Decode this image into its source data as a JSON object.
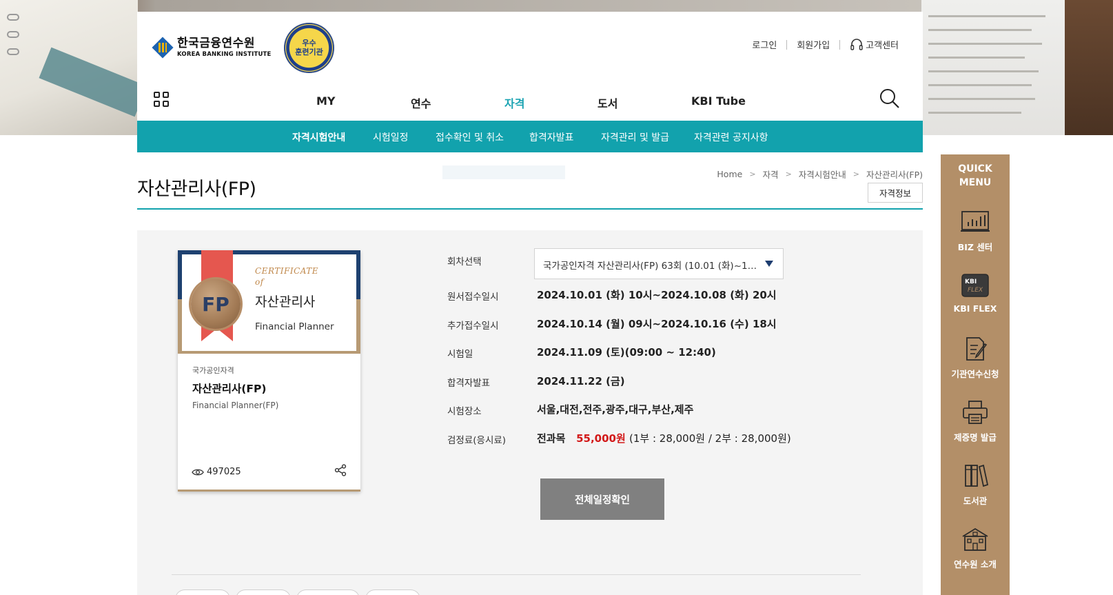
{
  "site": {
    "logo_ko": "한국금융연수원",
    "logo_en": "KOREA BANKING INSTITUTE",
    "badge_line1": "우수",
    "badge_line2": "훈련기관"
  },
  "utility": {
    "login": "로그인",
    "signup": "회원가입",
    "support": "고객센터"
  },
  "gnb": [
    {
      "label": "MY"
    },
    {
      "label": "연수"
    },
    {
      "label": "자격"
    },
    {
      "label": "도서"
    },
    {
      "label": "KBI Tube"
    }
  ],
  "subnav": [
    {
      "label": "자격시험안내"
    },
    {
      "label": "시험일정"
    },
    {
      "label": "접수확인 및 취소"
    },
    {
      "label": "합격자발표"
    },
    {
      "label": "자격관리 및 발급"
    },
    {
      "label": "자격관련 공지사항"
    }
  ],
  "page": {
    "title": "자산관리사(FP)",
    "info_button": "자격정보",
    "breadcrumb": [
      "Home",
      "자격",
      "자격시험안내",
      "자산관리사(FP)"
    ]
  },
  "card": {
    "cert_label_1": "CERTIFICATE",
    "cert_label_2": "of",
    "seal": "FP",
    "cert_name": "자산관리사",
    "cert_en": "Financial Planner",
    "category": "국가공인자격",
    "name": "자산관리사(FP)",
    "name_en": "Financial Planner(FP)",
    "views": "497025"
  },
  "exam": {
    "round_label": "회차선택",
    "round_value": "국가공인자격 자산관리사(FP) 63회 (10.01 (화)~1…",
    "apply_label": "원서접수일시",
    "apply_value": "2024.10.01 (화) 10시~2024.10.08 (화) 20시",
    "extra_label": "추가접수일시",
    "extra_value": "2024.10.14 (월) 09시~2024.10.16 (수) 18시",
    "date_label": "시험일",
    "date_value": "2024.11.09 (토)(09:00 ~ 12:40)",
    "result_label": "합격자발표",
    "result_value": "2024.11.22 (금)",
    "place_label": "시험장소",
    "place_value": "서울,대전,전주,광주,대구,부산,제주",
    "fee_label": "검정료(응시료)",
    "fee_scope": "전과목",
    "fee_amount": "55,000원",
    "fee_detail": "(1부 : 28,000원 / 2부 : 28,000원)",
    "schedule_button": "전체일정확인"
  },
  "quick_menu": {
    "title_1": "QUICK",
    "title_2": "MENU",
    "items": [
      {
        "label": "BIZ 센터",
        "icon": "chart-monitor-icon"
      },
      {
        "label": "KBI FLEX",
        "icon": "kbi-flex-icon"
      },
      {
        "label": "기관연수신청",
        "icon": "document-pen-icon"
      },
      {
        "label": "제증명 발급",
        "icon": "printer-icon"
      },
      {
        "label": "도서관",
        "icon": "books-icon"
      },
      {
        "label": "연수원 소개",
        "icon": "building-icon"
      }
    ]
  },
  "colors": {
    "accent": "#12a2ad",
    "quick_menu": "#b38f68",
    "fee_highlight": "#d21919"
  }
}
